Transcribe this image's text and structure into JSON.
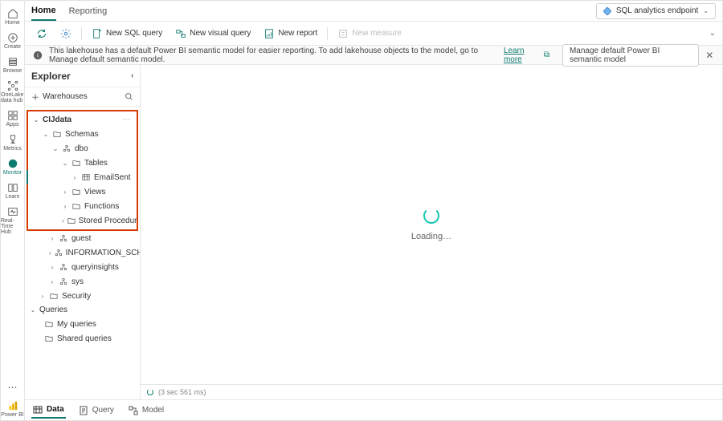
{
  "leftbar": {
    "home": "Home",
    "create": "Create",
    "browse": "Browse",
    "onelake": "OneLake data hub",
    "apps": "Apps",
    "metrics": "Metrics",
    "monitor": "Monitor",
    "learn": "Learn",
    "realtime": "Real-Time Hub",
    "powerbi": "Power BI"
  },
  "tabs": {
    "home": "Home",
    "reporting": "Reporting"
  },
  "mode_dropdown": "SQL analytics endpoint",
  "toolbar": {
    "refresh": "",
    "settings": "",
    "new_sql": "New SQL query",
    "new_visual": "New visual query",
    "new_report": "New report",
    "new_measure": "New measure"
  },
  "infobar": {
    "text": "This lakehouse has a default Power BI semantic model for easier reporting. To add lakehouse objects to the model, go to Manage default semantic model. ",
    "link": "Learn more",
    "button": "Manage default Power BI semantic model"
  },
  "explorer": {
    "title": "Explorer",
    "warehouses_btn": "Warehouses",
    "tree": {
      "root": "CIJdata",
      "schemas": "Schemas",
      "dbo": "dbo",
      "tables": "Tables",
      "emailsent": "EmailSent",
      "views": "Views",
      "functions": "Functions",
      "sprocs": "Stored Procedur…",
      "guest": "guest",
      "infoschema": "INFORMATION_SCHE…",
      "queryinsights": "queryinsights",
      "sys": "sys",
      "security": "Security",
      "queries": "Queries",
      "myqueries": "My queries",
      "sharedqueries": "Shared queries"
    }
  },
  "canvas": {
    "loading": "Loading…",
    "runtime": "(3 sec 561 ms)"
  },
  "bottom_tabs": {
    "data": "Data",
    "query": "Query",
    "model": "Model"
  }
}
